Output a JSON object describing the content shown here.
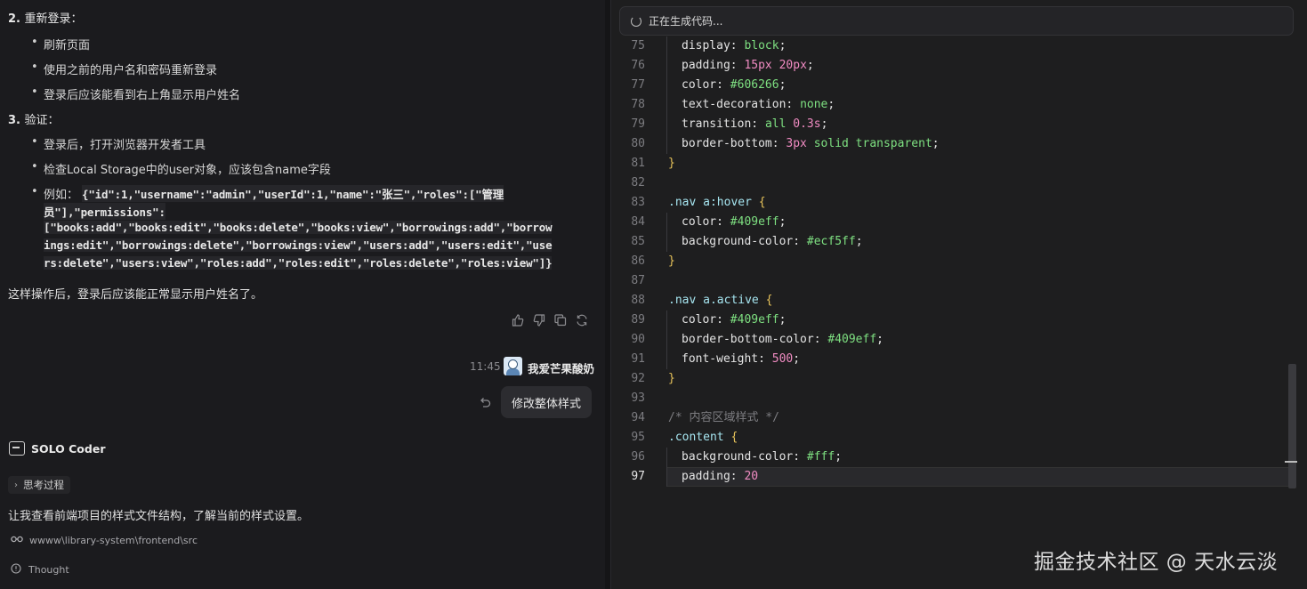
{
  "chat": {
    "step2": {
      "num": "2.",
      "title": "重新登录："
    },
    "step2_items": [
      "刷新页面",
      "使用之前的用户名和密码重新登录",
      "登录后应该能看到右上角显示用户姓名"
    ],
    "step3": {
      "num": "3.",
      "title": "验证："
    },
    "step3_items": [
      "登录后，打开浏览器开发者工具",
      "检查Local Storage中的user对象，应该包含name字段"
    ],
    "example_label": "例如：",
    "example_code": [
      "{\"id\":1,\"username\":\"admin\",\"userId\":1,\"name\":\"张三\",\"roles\":[\"管理",
      "员\"],\"permissions\":",
      "[\"books:add\",\"books:edit\",\"books:delete\",\"books:view\",\"borrowings:add\",\"borrow",
      "ings:edit\",\"borrowings:delete\",\"borrowings:view\",\"users:add\",\"users:edit\",\"use",
      "rs:delete\",\"users:view\",\"roles:add\",\"roles:edit\",\"roles:delete\",\"roles:view\"]}"
    ],
    "conclusion": "这样操作后，登录后应该能正常显示用户姓名了。",
    "message_time": "11:45",
    "user_name": "我爱芒果酸奶",
    "user_message": "修改整体样式",
    "agent_name": "SOLO Coder",
    "thinking_label": "思考过程",
    "agent_text": "让我查看前端项目的样式文件结构，了解当前的样式设置。",
    "path_text": "wwww\\library-system\\frontend\\src",
    "thought_label": "Thought"
  },
  "editor": {
    "status": "正在生成代码...",
    "current_line": 97,
    "lines": [
      {
        "no": "75",
        "tokens": [
          [
            "p",
            "display"
          ],
          [
            "k",
            ": "
          ],
          [
            "v",
            "block"
          ],
          [
            "k",
            ";"
          ]
        ],
        "indent": true
      },
      {
        "no": "76",
        "tokens": [
          [
            "p",
            "padding"
          ],
          [
            "k",
            ": "
          ],
          [
            "n",
            "15px 20px"
          ],
          [
            "k",
            ";"
          ]
        ],
        "indent": true
      },
      {
        "no": "77",
        "tokens": [
          [
            "p",
            "color"
          ],
          [
            "k",
            ": "
          ],
          [
            "v",
            "#606266"
          ],
          [
            "k",
            ";"
          ]
        ],
        "indent": true
      },
      {
        "no": "78",
        "tokens": [
          [
            "p",
            "text-decoration"
          ],
          [
            "k",
            ": "
          ],
          [
            "v",
            "none"
          ],
          [
            "k",
            ";"
          ]
        ],
        "indent": true
      },
      {
        "no": "79",
        "tokens": [
          [
            "p",
            "transition"
          ],
          [
            "k",
            ": "
          ],
          [
            "v",
            "all "
          ],
          [
            "n",
            "0.3s"
          ],
          [
            "k",
            ";"
          ]
        ],
        "indent": true
      },
      {
        "no": "80",
        "tokens": [
          [
            "p",
            "border-bottom"
          ],
          [
            "k",
            ": "
          ],
          [
            "n",
            "3px "
          ],
          [
            "v",
            "solid transparent"
          ],
          [
            "k",
            ";"
          ]
        ],
        "indent": true
      },
      {
        "no": "81",
        "tokens": [
          [
            "b",
            "}"
          ]
        ],
        "indent": false
      },
      {
        "no": "82",
        "tokens": [],
        "indent": false
      },
      {
        "no": "83",
        "tokens": [
          [
            "s",
            ".nav a:hover "
          ],
          [
            "b",
            "{"
          ]
        ],
        "indent": false
      },
      {
        "no": "84",
        "tokens": [
          [
            "p",
            "color"
          ],
          [
            "k",
            ": "
          ],
          [
            "v",
            "#409eff"
          ],
          [
            "k",
            ";"
          ]
        ],
        "indent": true
      },
      {
        "no": "85",
        "tokens": [
          [
            "p",
            "background-color"
          ],
          [
            "k",
            ": "
          ],
          [
            "v",
            "#ecf5ff"
          ],
          [
            "k",
            ";"
          ]
        ],
        "indent": true
      },
      {
        "no": "86",
        "tokens": [
          [
            "b",
            "}"
          ]
        ],
        "indent": false
      },
      {
        "no": "87",
        "tokens": [],
        "indent": false
      },
      {
        "no": "88",
        "tokens": [
          [
            "s",
            ".nav a.active "
          ],
          [
            "b",
            "{"
          ]
        ],
        "indent": false
      },
      {
        "no": "89",
        "tokens": [
          [
            "p",
            "color"
          ],
          [
            "k",
            ": "
          ],
          [
            "v",
            "#409eff"
          ],
          [
            "k",
            ";"
          ]
        ],
        "indent": true
      },
      {
        "no": "90",
        "tokens": [
          [
            "p",
            "border-bottom-color"
          ],
          [
            "k",
            ": "
          ],
          [
            "v",
            "#409eff"
          ],
          [
            "k",
            ";"
          ]
        ],
        "indent": true
      },
      {
        "no": "91",
        "tokens": [
          [
            "p",
            "font-weight"
          ],
          [
            "k",
            ": "
          ],
          [
            "n",
            "500"
          ],
          [
            "k",
            ";"
          ]
        ],
        "indent": true
      },
      {
        "no": "92",
        "tokens": [
          [
            "b",
            "}"
          ]
        ],
        "indent": false
      },
      {
        "no": "93",
        "tokens": [],
        "indent": false
      },
      {
        "no": "94",
        "tokens": [
          [
            "c",
            "/* 内容区域样式 */"
          ]
        ],
        "indent": false
      },
      {
        "no": "95",
        "tokens": [
          [
            "s",
            ".content "
          ],
          [
            "b",
            "{"
          ]
        ],
        "indent": false
      },
      {
        "no": "96",
        "tokens": [
          [
            "p",
            "background-color"
          ],
          [
            "k",
            ": "
          ],
          [
            "v",
            "#fff"
          ],
          [
            "k",
            ";"
          ]
        ],
        "indent": true
      },
      {
        "no": "97",
        "tokens": [
          [
            "p",
            "padding"
          ],
          [
            "k",
            ": "
          ],
          [
            "n",
            "20"
          ]
        ],
        "indent": true
      }
    ]
  },
  "watermark": "掘金技术社区 @ 天水云淡",
  "icons": {
    "thumb_up": "thumb-up-icon",
    "thumb_down": "thumb-down-icon",
    "copy": "copy-icon",
    "retry": "refresh-icon",
    "undo": "undo-icon",
    "agent": "terminal-icon",
    "path": "glasses-icon",
    "thought": "info-icon",
    "spinner": "loading-spinner-icon"
  }
}
